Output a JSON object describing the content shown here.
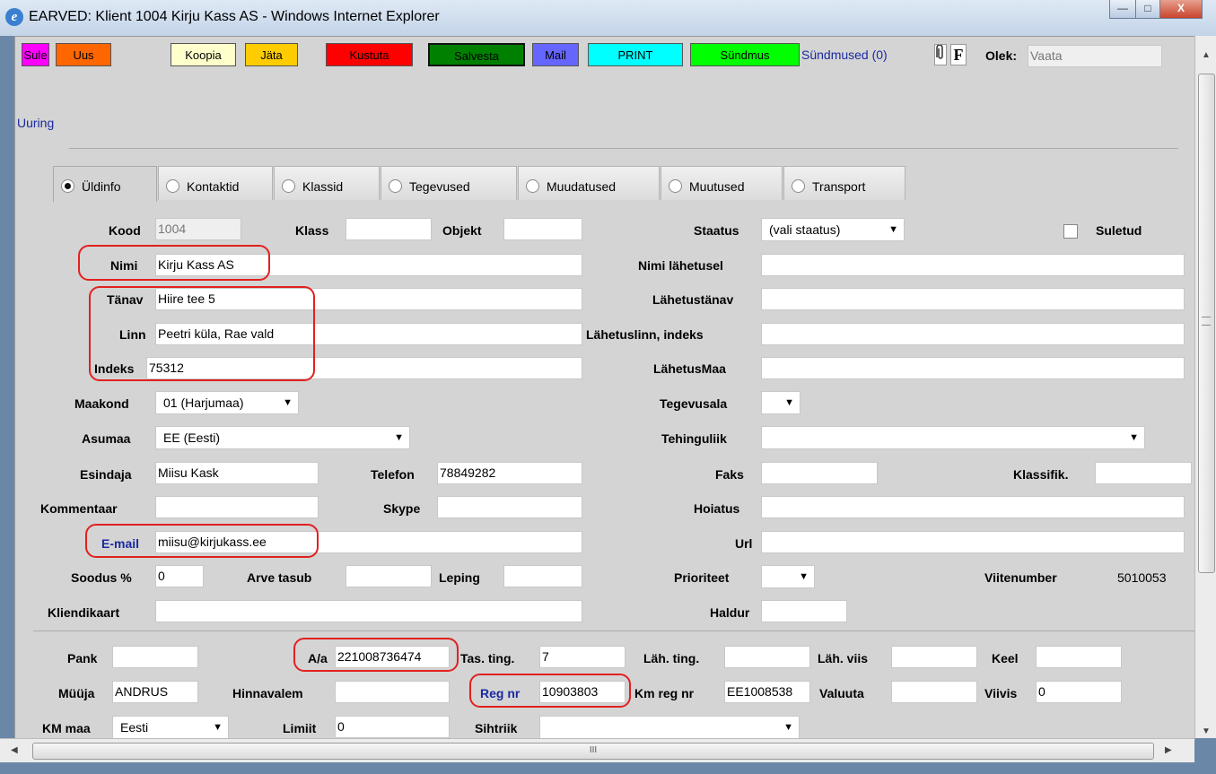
{
  "window": {
    "title": "EARVED: Klient 1004  Kirju Kass AS - Windows Internet Explorer",
    "minimize": "—",
    "maximize": "□",
    "close": "X"
  },
  "toolbar": {
    "sule": "Sule",
    "uus": "Uus",
    "koopia": "Koopia",
    "jata": "Jäta",
    "kustuta": "Kustuta",
    "salvesta": "Salvesta",
    "mail": "Mail",
    "print": "PRINT",
    "sundmus": "Sündmus",
    "sundmused": "Sündmused (0)",
    "f": "F",
    "olek_label": "Olek:",
    "olek_value": "Vaata",
    "uuring": "Uuring"
  },
  "tabs": [
    "Üldinfo",
    "Kontaktid",
    "Klassid",
    "Tegevused",
    "Muudatused",
    "Muutused",
    "Transport"
  ],
  "fields": {
    "kood_label": "Kood",
    "kood_value": "1004",
    "klass_label": "Klass",
    "objekt_label": "Objekt",
    "staatus_label": "Staatus",
    "staatus_value": "(vali staatus)",
    "suletud_label": "Suletud",
    "nimi_label": "Nimi",
    "nimi_value": "Kirju Kass AS",
    "nimi_lahetusel_label": "Nimi lähetusel",
    "tanav_label": "Tänav",
    "tanav_value": "Hiire tee 5",
    "lahetustanav_label": "Lähetustänav",
    "linn_label": "Linn",
    "linn_value": "Peetri küla, Rae vald",
    "lahetuslinn_label": "Lähetuslinn, indeks",
    "indeks_label": "Indeks",
    "indeks_value": "75312",
    "lahetusmaa_label": "LähetusMaa",
    "maakond_label": "Maakond",
    "maakond_value": "01 (Harjumaa)",
    "tegevusala_label": "Tegevusala",
    "asumaa_label": "Asumaa",
    "asumaa_value": "EE (Eesti)",
    "tehinguliik_label": "Tehinguliik",
    "esindaja_label": "Esindaja",
    "esindaja_value": "Miisu Kask",
    "telefon_label": "Telefon",
    "telefon_value": "78849282",
    "faks_label": "Faks",
    "klassifik_label": "Klassifik.",
    "kommentaar_label": "Kommentaar",
    "skype_label": "Skype",
    "hoiatus_label": "Hoiatus",
    "email_label": "E-mail",
    "email_value": "miisu@kirjukass.ee",
    "url_label": "Url",
    "soodus_label": "Soodus %",
    "soodus_value": "0",
    "arve_tasub_label": "Arve tasub",
    "leping_label": "Leping",
    "prioriteet_label": "Prioriteet",
    "viitenumber_label": "Viitenumber",
    "viitenumber_value": "5010053",
    "kliendikaart_label": "Kliendikaart",
    "haldur_label": "Haldur",
    "pank_label": "Pank",
    "aa_label": "A/a",
    "aa_value": "221008736474",
    "tas_ting_label": "Tas. ting.",
    "tas_ting_value": "7",
    "lah_ting_label": "Läh. ting.",
    "lah_viis_label": "Läh. viis",
    "keel_label": "Keel",
    "muuja_label": "Müüja",
    "muuja_value": "ANDRUS",
    "hinnavalem_label": "Hinnavalem",
    "reg_nr_label": "Reg nr",
    "reg_nr_value": "10903803",
    "km_reg_nr_label": "Km reg nr",
    "km_reg_nr_value": "EE1008538",
    "valuuta_label": "Valuuta",
    "viivis_label": "Viivis",
    "viivis_value": "0",
    "km_maa_label": "KM maa",
    "km_maa_value": "Eesti",
    "limiit_label": "Limiit",
    "limiit_value": "0",
    "sihtriik_label": "Sihtriik"
  },
  "scroll": {
    "hgrip": "III"
  },
  "colors": {
    "sule": "#ff00ff",
    "uus": "#ff6600",
    "koopia": "#ffffcc",
    "jata": "#ffcc00",
    "kustuta": "#ff0000",
    "salvesta": "#008000",
    "mail": "#6666ff",
    "print": "#00ffff",
    "sundmus": "#00ff00",
    "highlight": "#e22020"
  }
}
